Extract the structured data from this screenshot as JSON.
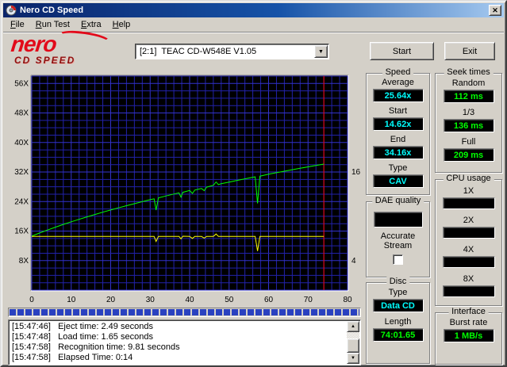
{
  "window": {
    "title": "Nero CD Speed"
  },
  "menu": {
    "items": [
      "File",
      "Run Test",
      "Extra",
      "Help"
    ]
  },
  "toolbar": {
    "logo": {
      "line1": "nero",
      "line2": "CD SPEED"
    },
    "drive_select": {
      "value": "[2:1]  TEAC CD-W548E V1.05"
    },
    "start_label": "Start",
    "exit_label": "Exit"
  },
  "chart_data": {
    "type": "line",
    "background": "#000000",
    "grid_color": "#2222aa",
    "grid_color_major": "#3333cc",
    "x_axis": {
      "min": 0,
      "max": 80,
      "tick_step": 10,
      "minor_step": 2,
      "ticks": [
        0,
        10,
        20,
        30,
        40,
        50,
        60,
        70,
        80
      ]
    },
    "y_axis_left": {
      "min": 0,
      "max": 58,
      "tick_step": 8,
      "minor_step": 2,
      "ticks": [
        8,
        16,
        24,
        32,
        40,
        48,
        56
      ],
      "tick_suffix": "X"
    },
    "y_axis_right": {
      "scale_of_left": 0.5,
      "ticks": [
        16,
        4
      ]
    },
    "end_marker": {
      "x": 74,
      "color": "#ff0000"
    },
    "series": [
      {
        "name": "read-speed",
        "color": "#00ff00",
        "axis": "left",
        "points": [
          [
            0,
            14.62
          ],
          [
            2,
            15.48
          ],
          [
            4,
            16.29
          ],
          [
            6,
            17.06
          ],
          [
            8,
            17.8
          ],
          [
            10,
            18.51
          ],
          [
            12,
            19.19
          ],
          [
            14,
            19.85
          ],
          [
            16,
            20.49
          ],
          [
            18,
            21.11
          ],
          [
            20,
            21.71
          ],
          [
            22,
            22.3
          ],
          [
            24,
            22.87
          ],
          [
            26,
            23.42
          ],
          [
            28,
            23.97
          ],
          [
            30,
            24.5
          ],
          [
            31,
            24.75
          ],
          [
            31.5,
            21.7
          ],
          [
            32.1,
            25.0
          ],
          [
            34,
            25.53
          ],
          [
            36,
            26.03
          ],
          [
            37.3,
            26.35
          ],
          [
            37.8,
            25.2
          ],
          [
            38.3,
            26.5
          ],
          [
            40,
            27.0
          ],
          [
            40.7,
            26.2
          ],
          [
            41.3,
            27.1
          ],
          [
            43,
            27.55
          ],
          [
            43.7,
            26.95
          ],
          [
            44.3,
            27.9
          ],
          [
            46,
            28.39
          ],
          [
            46.7,
            29.3
          ],
          [
            47.3,
            28.6
          ],
          [
            48,
            28.84
          ],
          [
            50,
            29.29
          ],
          [
            52,
            29.72
          ],
          [
            54,
            30.15
          ],
          [
            56,
            30.58
          ],
          [
            56.6,
            30.7
          ],
          [
            57.2,
            23.5
          ],
          [
            57.8,
            30.9
          ],
          [
            58.5,
            31.05
          ],
          [
            60,
            31.41
          ],
          [
            62,
            31.82
          ],
          [
            64,
            32.22
          ],
          [
            66,
            32.62
          ],
          [
            68,
            33.01
          ],
          [
            70,
            33.4
          ],
          [
            72,
            33.78
          ],
          [
            74,
            34.16
          ]
        ]
      },
      {
        "name": "rotation-speed",
        "color": "#ffff00",
        "axis": "right",
        "points": [
          [
            0,
            7.28
          ],
          [
            30,
            7.28
          ],
          [
            31,
            7.28
          ],
          [
            31.5,
            6.6
          ],
          [
            32.1,
            7.28
          ],
          [
            37.3,
            7.28
          ],
          [
            37.8,
            6.95
          ],
          [
            38.3,
            7.3
          ],
          [
            40,
            7.28
          ],
          [
            40.7,
            7.0
          ],
          [
            41.3,
            7.28
          ],
          [
            43,
            7.28
          ],
          [
            43.7,
            7.05
          ],
          [
            44.3,
            7.28
          ],
          [
            46,
            7.28
          ],
          [
            46.7,
            7.6
          ],
          [
            47.3,
            7.28
          ],
          [
            56.6,
            7.28
          ],
          [
            57.2,
            5.3
          ],
          [
            57.8,
            7.28
          ],
          [
            74,
            7.28
          ]
        ]
      }
    ]
  },
  "panels": {
    "speed": {
      "title": "Speed",
      "fields": [
        {
          "label": "Average",
          "value": "25.64x",
          "color": "#00ffff"
        },
        {
          "label": "Start",
          "value": "14.62x",
          "color": "#00ffff"
        },
        {
          "label": "End",
          "value": "34.16x",
          "color": "#00ffff"
        },
        {
          "label": "Type",
          "value": "CAV",
          "color": "#00ffff"
        }
      ]
    },
    "seek": {
      "title": "Seek times",
      "fields": [
        {
          "label": "Random",
          "value": "112 ms",
          "color": "#00ff00"
        },
        {
          "label": "1/3",
          "value": "136 ms",
          "color": "#00ff00"
        },
        {
          "label": "Full",
          "value": "209 ms",
          "color": "#00ff00"
        }
      ]
    },
    "cpu": {
      "title": "CPU usage",
      "fields": [
        {
          "label": "1X",
          "value": ""
        },
        {
          "label": "2X",
          "value": ""
        },
        {
          "label": "4X",
          "value": ""
        },
        {
          "label": "8X",
          "value": ""
        }
      ]
    },
    "dae": {
      "title": "DAE quality",
      "value": "",
      "option_label": "Accurate Stream",
      "checkbox_checked": false
    },
    "disc": {
      "title": "Disc",
      "fields": [
        {
          "label": "Type",
          "value": "Data CD",
          "color": "#00ffff"
        },
        {
          "label": "Length",
          "value": "74:01.65",
          "color": "#00ff00"
        }
      ]
    },
    "iface": {
      "title": "Interface",
      "fields": [
        {
          "label": "Burst rate",
          "value": "1 MB/s",
          "color": "#00ff00"
        }
      ]
    }
  },
  "progress": {
    "fraction": 1.0
  },
  "log": {
    "lines": [
      "[15:47:46]   Eject time: 2.49 seconds",
      "[15:47:48]   Load time: 1.65 seconds",
      "[15:47:58]   Recognition time: 9.81 seconds",
      "[15:47:58]   Elapsed Time: 0:14"
    ]
  }
}
